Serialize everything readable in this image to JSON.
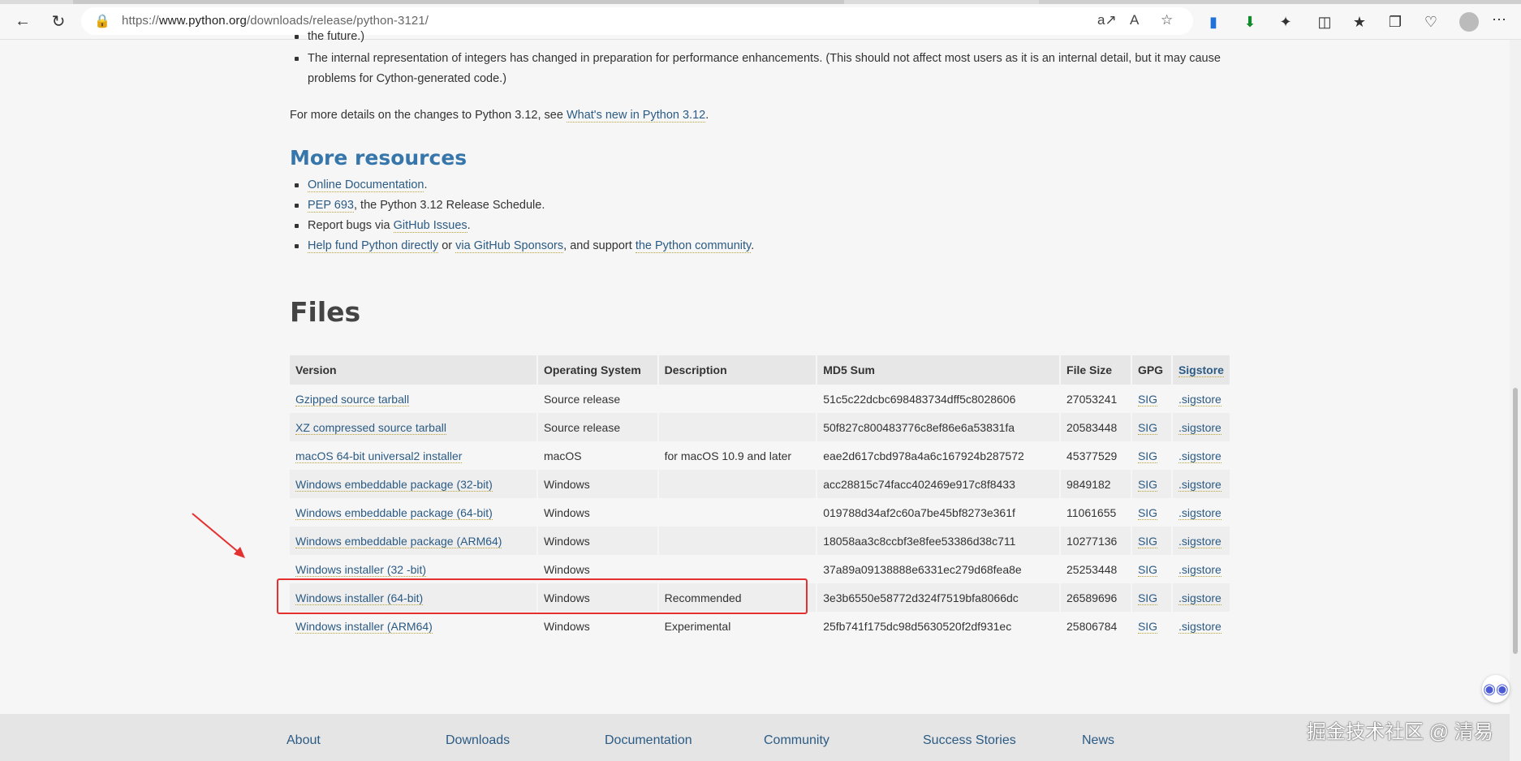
{
  "browser": {
    "url_prefix": "https://",
    "url_domain": "www.python.org",
    "url_path": "/downloads/release/python-3121/",
    "icons": {
      "back": "back-arrow-icon",
      "refresh": "refresh-icon",
      "lock": "lock-icon",
      "read_aloud": "read-aloud-icon",
      "font": "text-size-icon",
      "favorite": "star-icon"
    }
  },
  "top": {
    "clipped_line": "the future.)",
    "bullet_internal_rep": "The internal representation of integers has changed in preparation for performance enhancements. (This should not affect most users as it is an internal detail, but it may cause",
    "bullet_internal_rep_cont": "problems for Cython-generated code.)",
    "details_prefix": "For more details on the changes to Python 3.12, see ",
    "details_link": "What's new in Python 3.12",
    "details_suffix": "."
  },
  "more_resources": {
    "heading": "More resources",
    "online_docs": "Online Documentation",
    "online_docs_suffix": ".",
    "pep": "PEP 693",
    "pep_suffix": ", the Python 3.12 Release Schedule.",
    "bugs_prefix": "Report bugs via ",
    "bugs_link": "GitHub Issues",
    "bugs_suffix": ".",
    "fund_link": "Help fund Python directly",
    "fund_or": " or ",
    "sponsors_link": "via GitHub Sponsors",
    "support_text": ", and support ",
    "community_link": "the Python community",
    "community_suffix": "."
  },
  "files": {
    "heading": "Files",
    "columns": [
      "Version",
      "Operating System",
      "Description",
      "MD5 Sum",
      "File Size",
      "GPG",
      "Sigstore"
    ],
    "rows": [
      {
        "version": "Gzipped source tarball",
        "os": "Source release",
        "desc": "",
        "md5": "51c5c22dcbc698483734dff5c8028606",
        "size": "27053241",
        "gpg": "SIG",
        "sigstore": ".sigstore"
      },
      {
        "version": "XZ compressed source tarball",
        "os": "Source release",
        "desc": "",
        "md5": "50f827c800483776c8ef86e6a53831fa",
        "size": "20583448",
        "gpg": "SIG",
        "sigstore": ".sigstore"
      },
      {
        "version": "macOS 64-bit universal2 installer",
        "os": "macOS",
        "desc": "for macOS 10.9 and later",
        "md5": "eae2d617cbd978a4a6c167924b287572",
        "size": "45377529",
        "gpg": "SIG",
        "sigstore": ".sigstore"
      },
      {
        "version": "Windows embeddable package (32-bit)",
        "os": "Windows",
        "desc": "",
        "md5": "acc28815c74facc402469e917c8f8433",
        "size": "9849182",
        "gpg": "SIG",
        "sigstore": ".sigstore"
      },
      {
        "version": "Windows embeddable package (64-bit)",
        "os": "Windows",
        "desc": "",
        "md5": "019788d34af2c60a7be45bf8273e361f",
        "size": "11061655",
        "gpg": "SIG",
        "sigstore": ".sigstore"
      },
      {
        "version": "Windows embeddable package (ARM64)",
        "os": "Windows",
        "desc": "",
        "md5": "18058aa3c8ccbf3e8fee53386d38c711",
        "size": "10277136",
        "gpg": "SIG",
        "sigstore": ".sigstore"
      },
      {
        "version": "Windows installer (32 -bit)",
        "os": "Windows",
        "desc": "",
        "md5": "37a89a09138888e6331ec279d68fea8e",
        "size": "25253448",
        "gpg": "SIG",
        "sigstore": ".sigstore"
      },
      {
        "version": "Windows installer (64-bit)",
        "os": "Windows",
        "desc": "Recommended",
        "md5": "3e3b6550e58772d324f7519bfa8066dc",
        "size": "26589696",
        "gpg": "SIG",
        "sigstore": ".sigstore"
      },
      {
        "version": "Windows installer (ARM64)",
        "os": "Windows",
        "desc": "Experimental",
        "md5": "25fb741f175dc98d5630520f2df931ec",
        "size": "25806784",
        "gpg": "SIG",
        "sigstore": ".sigstore"
      }
    ]
  },
  "footer": {
    "about": "About",
    "downloads": "Downloads",
    "documentation": "Documentation",
    "community": "Community",
    "success": "Success Stories",
    "news": "News"
  },
  "watermark": "掘金技术社区 @ 清易",
  "colors": {
    "link": "#2b5b84",
    "heading_blue": "#3776ab",
    "highlight_red": "#e53030"
  }
}
